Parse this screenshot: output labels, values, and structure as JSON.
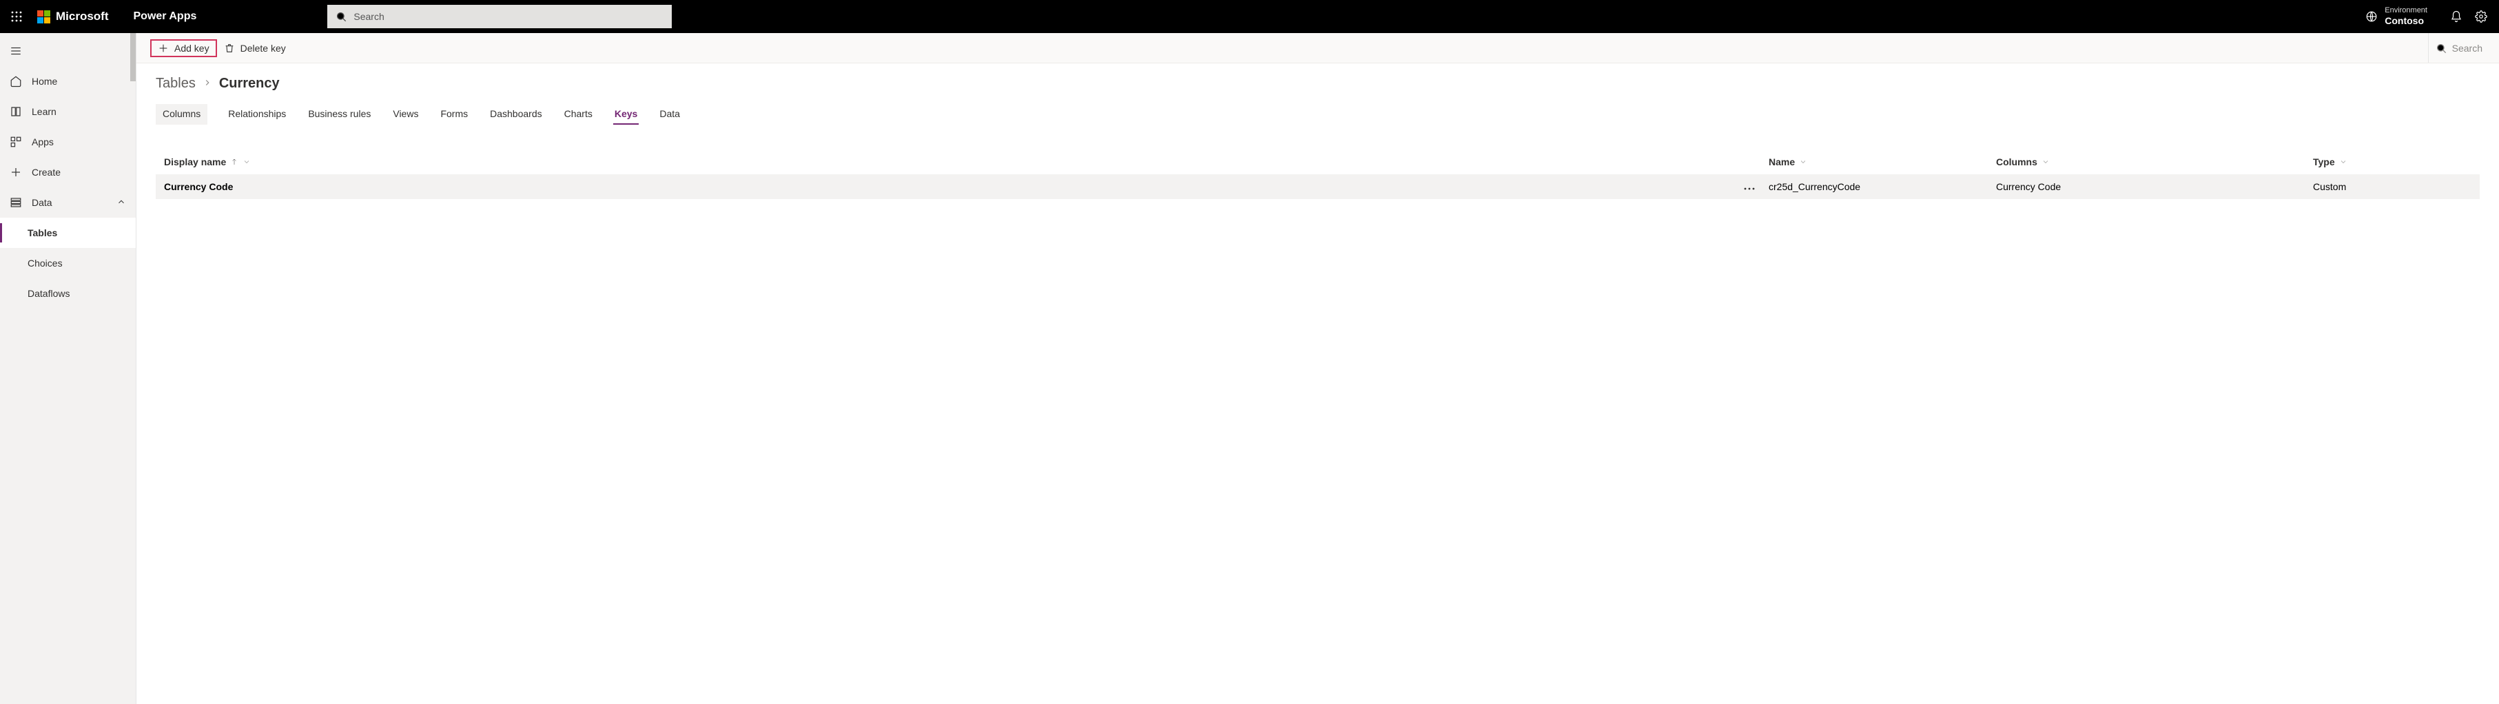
{
  "header": {
    "brand_text": "Microsoft",
    "product": "Power Apps",
    "search_placeholder": "Search",
    "env_label": "Environment",
    "env_name": "Contoso"
  },
  "leftnav": {
    "home": "Home",
    "learn": "Learn",
    "apps": "Apps",
    "create": "Create",
    "data": "Data",
    "tables": "Tables",
    "choices": "Choices",
    "dataflows": "Dataflows"
  },
  "cmdbar": {
    "add_key": "Add key",
    "delete_key": "Delete key",
    "search": "Search"
  },
  "breadcrumb": {
    "root": "Tables",
    "current": "Currency"
  },
  "tabs": {
    "columns": "Columns",
    "relationships": "Relationships",
    "business_rules": "Business rules",
    "views": "Views",
    "forms": "Forms",
    "dashboards": "Dashboards",
    "charts": "Charts",
    "keys": "Keys",
    "data": "Data"
  },
  "grid": {
    "headers": {
      "display_name": "Display name",
      "name": "Name",
      "columns": "Columns",
      "type": "Type"
    },
    "row": {
      "display_name": "Currency Code",
      "name": "cr25d_CurrencyCode",
      "columns": "Currency Code",
      "type": "Custom"
    }
  }
}
